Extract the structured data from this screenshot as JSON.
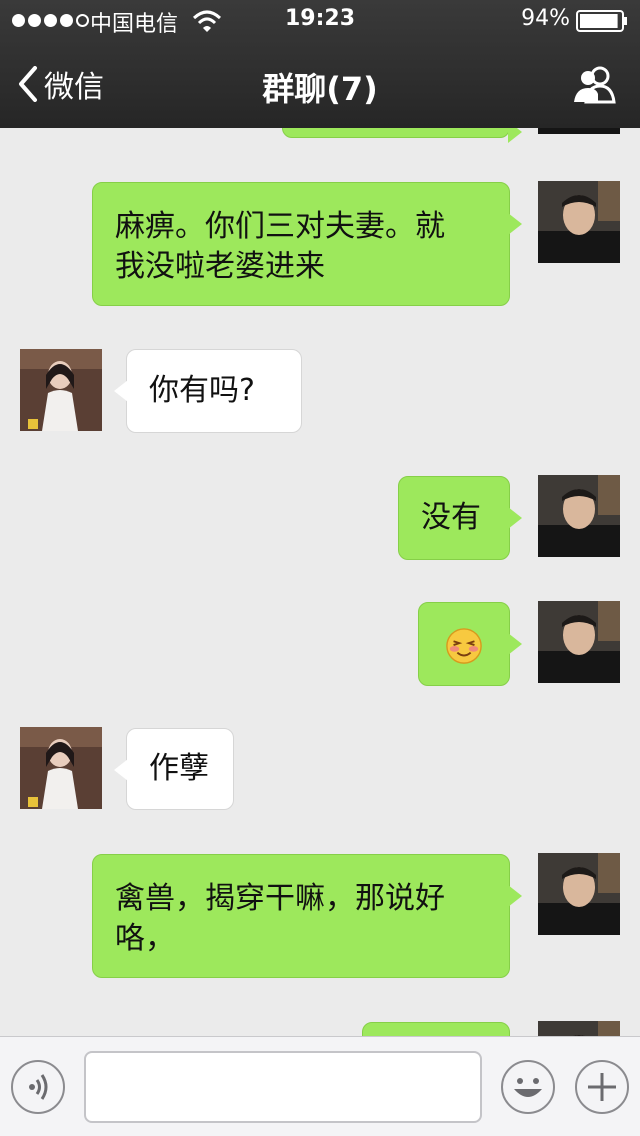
{
  "status_bar": {
    "carrier": "中国电信",
    "time": "19:23",
    "battery": "94%",
    "signal_bars": 4,
    "signal_total": 5,
    "battery_level": 0.94
  },
  "nav": {
    "back_label": "微信",
    "title": "群聊(7)"
  },
  "messages": [
    {
      "side": "out",
      "lines": [
        ""
      ]
    },
    {
      "side": "out",
      "lines": [
        "麻痹。你们三对夫妻。就",
        "我没啦老婆进来"
      ]
    },
    {
      "side": "in",
      "lines": [
        "你有吗?"
      ]
    },
    {
      "side": "out",
      "lines": [
        "没有"
      ]
    },
    {
      "side": "out",
      "emoji": "blushing-face-emoji"
    },
    {
      "side": "in",
      "lines": [
        "作孽"
      ]
    },
    {
      "side": "out",
      "lines": [
        "禽兽，揭穿干嘛，那说好",
        "咯，"
      ]
    },
    {
      "side": "out",
      "lines": [
        ""
      ]
    }
  ],
  "input": {
    "value": "",
    "placeholder": ""
  },
  "colors": {
    "nav_bg": "#2f2f2f",
    "chat_bg": "#ebebeb",
    "outgoing_bubble": "#9de85c",
    "incoming_bubble": "#ffffff"
  },
  "icons": {
    "back": "chevron-left-icon",
    "contacts": "group-contacts-icon",
    "voice": "voice-icon",
    "emoji": "smiley-icon",
    "plus": "plus-icon"
  }
}
